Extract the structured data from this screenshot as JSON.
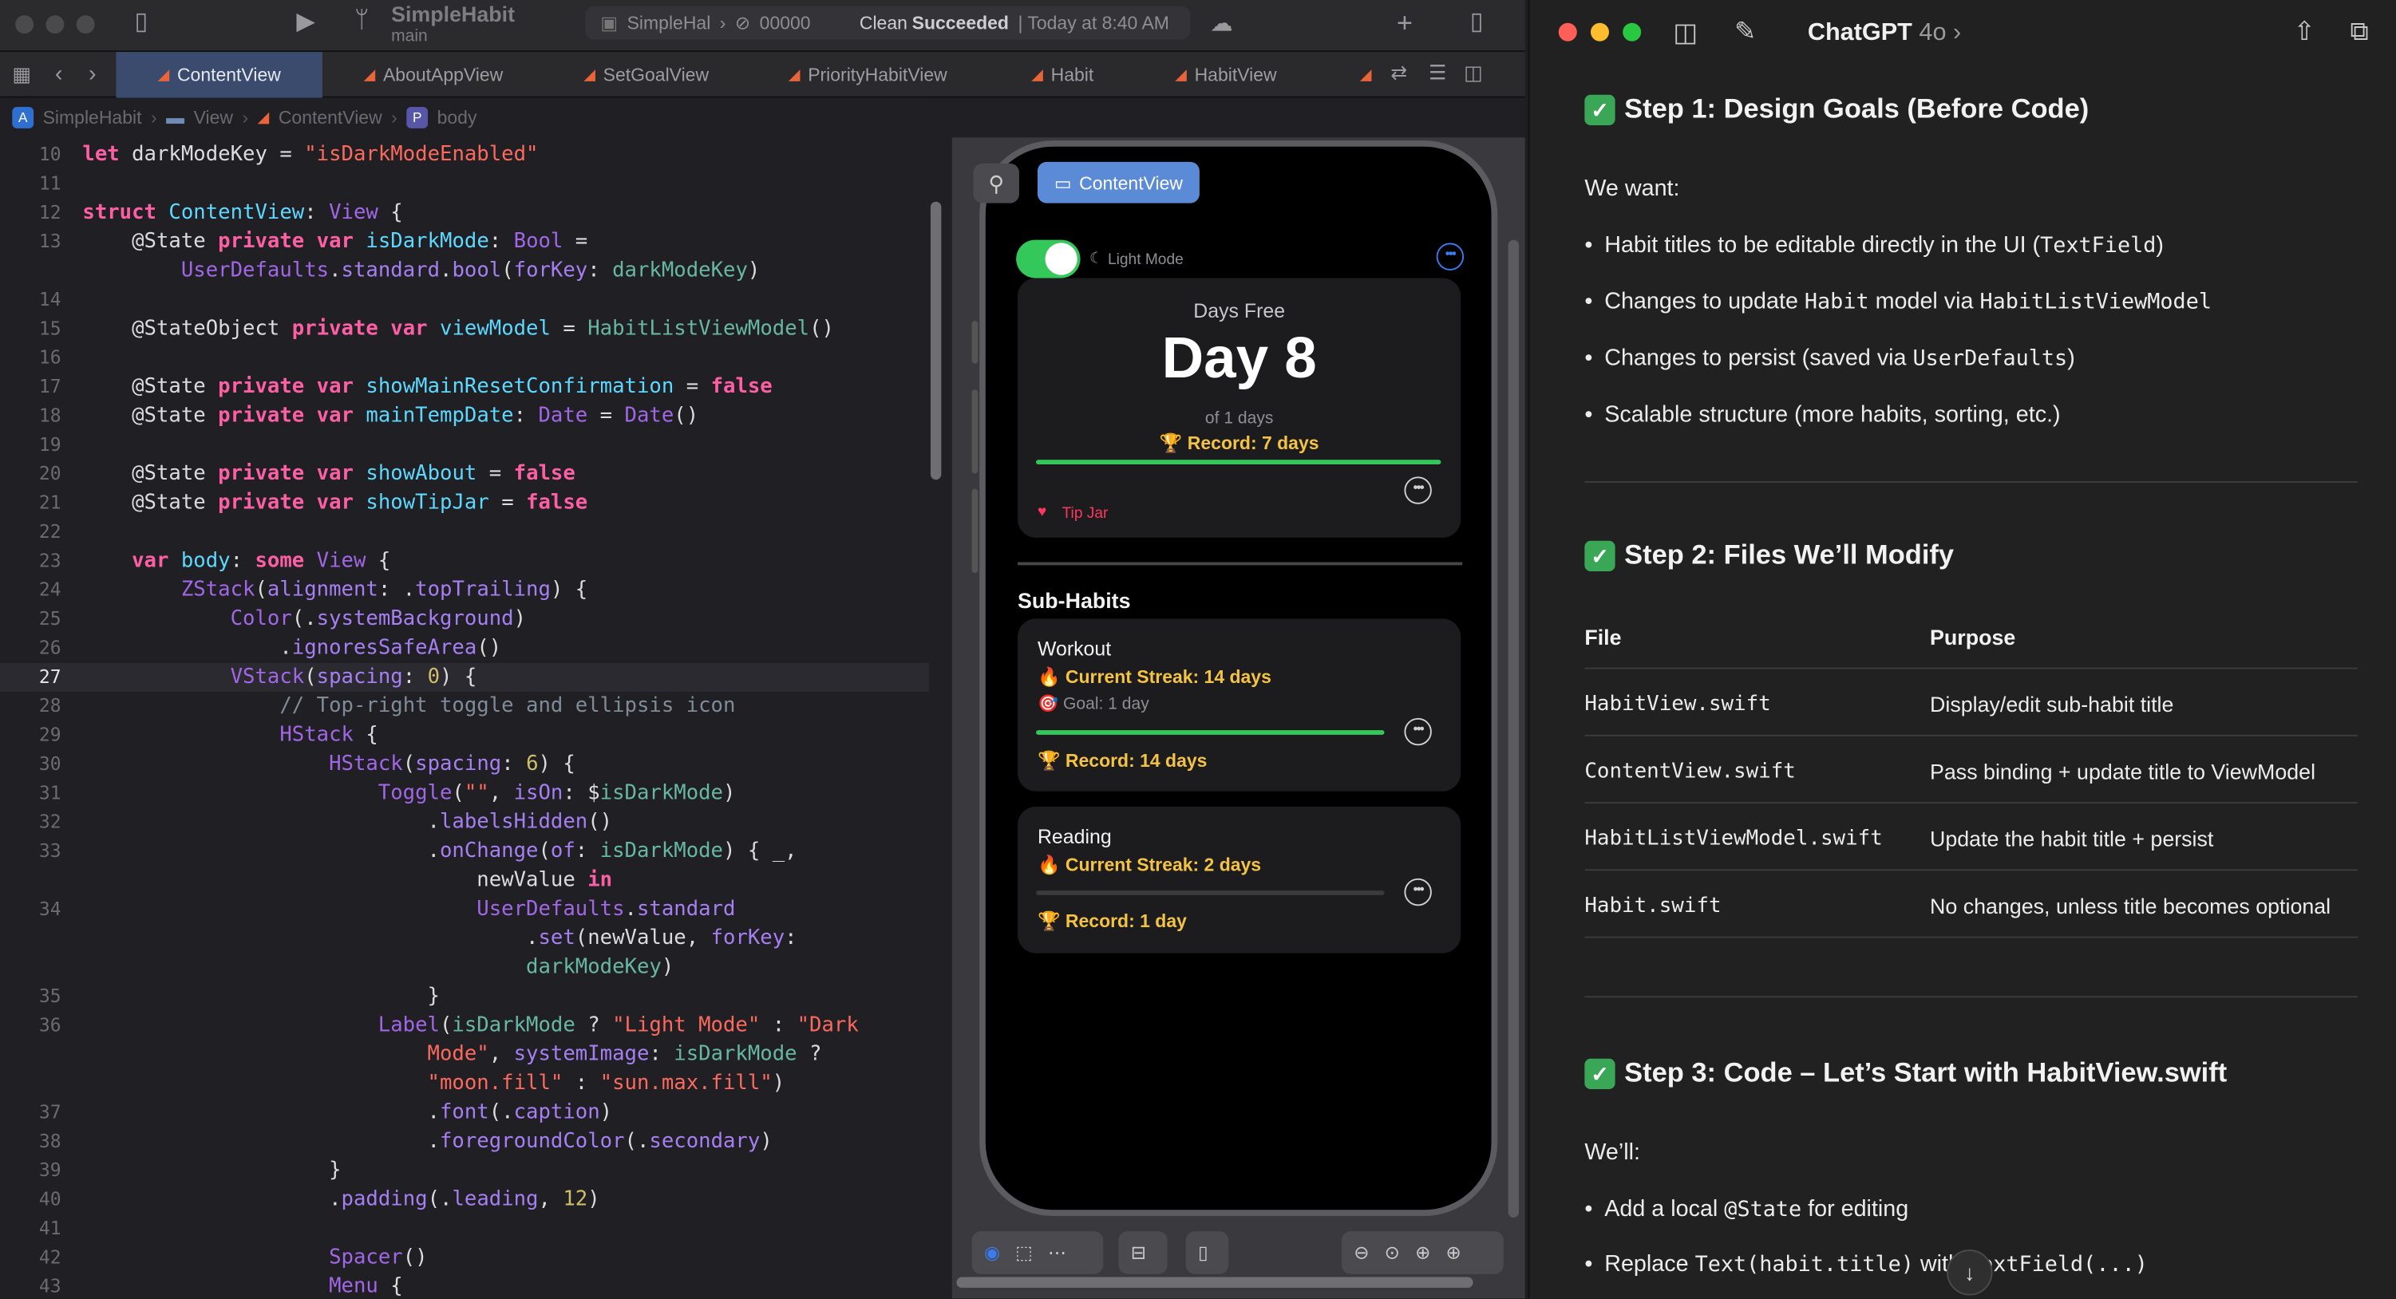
{
  "xcode": {
    "project_name": "SimpleHabit",
    "branch": "main",
    "status": {
      "scheme": "SimpleHal",
      "device": "00000",
      "message_prefix": "Clean",
      "message_strong": "Succeeded",
      "message_time": "| Today at 8:40 AM"
    },
    "tabs": [
      "ContentView",
      "AboutAppView",
      "SetGoalView",
      "PriorityHabitView",
      "Habit",
      "HabitView"
    ],
    "jumpbar": [
      "SimpleHabit",
      "View",
      "ContentView",
      "body"
    ],
    "code_lines": [
      {
        "n": "10",
        "html": "<span class=\"kw\">let</span> darkModeKey = <span class=\"st\">\"isDarkModeEnabled\"</span>"
      },
      {
        "n": "11",
        "html": ""
      },
      {
        "n": "12",
        "html": "<span class=\"kw\">struct</span> <span class=\"tz\">ContentView</span>: <span class=\"ty\">View</span> {"
      },
      {
        "n": "13",
        "html": "    @State <span class=\"kw\">private var</span> <span class=\"tz\">isDarkMode</span>: <span class=\"ty\">Bool</span> ="
      },
      {
        "n": "",
        "html": "        <span class=\"ty\">UserDefaults</span>.<span class=\"pr\">standard</span>.<span class=\"pr\">bool</span>(<span class=\"pr\">forKey</span>: <span class=\"fn\">darkModeKey</span>)"
      },
      {
        "n": "14",
        "html": ""
      },
      {
        "n": "15",
        "html": "    @StateObject <span class=\"kw\">private var</span> <span class=\"tz\">viewModel</span> = <span class=\"fn\">HabitListViewModel</span>()"
      },
      {
        "n": "16",
        "html": ""
      },
      {
        "n": "17",
        "html": "    @State <span class=\"kw\">private var</span> <span class=\"tz\">showMainResetConfirmation</span> = <span class=\"kw\">false</span>"
      },
      {
        "n": "18",
        "html": "    @State <span class=\"kw\">private var</span> <span class=\"tz\">mainTempDate</span>: <span class=\"ty\">Date</span> = <span class=\"ty\">Date</span>()"
      },
      {
        "n": "19",
        "html": ""
      },
      {
        "n": "20",
        "html": "    @State <span class=\"kw\">private var</span> <span class=\"tz\">showAbout</span> = <span class=\"kw\">false</span>"
      },
      {
        "n": "21",
        "html": "    @State <span class=\"kw\">private var</span> <span class=\"tz\">showTipJar</span> = <span class=\"kw\">false</span>"
      },
      {
        "n": "22",
        "html": ""
      },
      {
        "n": "23",
        "html": "    <span class=\"kw\">var</span> <span class=\"tz\">body</span>: <span class=\"kw\">some</span> <span class=\"ty\">View</span> {"
      },
      {
        "n": "24",
        "html": "        <span class=\"ty\">ZStack</span>(<span class=\"pr\">alignment</span>: .<span class=\"pr\">topTrailing</span>) {"
      },
      {
        "n": "25",
        "html": "            <span class=\"ty\">Color</span>(.<span class=\"pr\">systemBackground</span>)"
      },
      {
        "n": "26",
        "html": "                .<span class=\"pr\">ignoresSafeArea</span>()"
      },
      {
        "n": "27",
        "html": "            <span class=\"ty\">VStack</span>(<span class=\"pr\">spacing</span>: <span class=\"nm\">0</span>) {",
        "current": true
      },
      {
        "n": "28",
        "html": "                <span class=\"cm\">// Top-right toggle and ellipsis icon</span>"
      },
      {
        "n": "29",
        "html": "                <span class=\"ty\">HStack</span> {"
      },
      {
        "n": "30",
        "html": "                    <span class=\"ty\">HStack</span>(<span class=\"pr\">spacing</span>: <span class=\"nm\">6</span>) {"
      },
      {
        "n": "31",
        "html": "                        <span class=\"ty\">Toggle</span>(<span class=\"st\">\"\"</span>, <span class=\"pr\">isOn</span>: $<span class=\"fn\">isDarkMode</span>)"
      },
      {
        "n": "32",
        "html": "                            .<span class=\"pr\">labelsHidden</span>()"
      },
      {
        "n": "33",
        "html": "                            .<span class=\"pr\">onChange</span>(<span class=\"pr\">of</span>: <span class=\"fn\">isDarkMode</span>) { _,"
      },
      {
        "n": "",
        "html": "                                newValue <span class=\"kw\">in</span>"
      },
      {
        "n": "34",
        "html": "                                <span class=\"ty\">UserDefaults</span>.<span class=\"pr\">standard</span>"
      },
      {
        "n": "",
        "html": "                                    .<span class=\"pr\">set</span>(newValue, <span class=\"pr\">forKey</span>:"
      },
      {
        "n": "",
        "html": "                                    <span class=\"fn\">darkModeKey</span>)"
      },
      {
        "n": "35",
        "html": "                            }"
      },
      {
        "n": "36",
        "html": "                        <span class=\"ty\">Label</span>(<span class=\"fn\">isDarkMode</span> ? <span class=\"st\">\"Light Mode\"</span> : <span class=\"st\">\"Dark</span>"
      },
      {
        "n": "",
        "html": "                            <span class=\"st\">Mode\"</span>, <span class=\"pr\">systemImage</span>: <span class=\"fn\">isDarkMode</span> ?"
      },
      {
        "n": "",
        "html": "                            <span class=\"st\">\"moon.fill\"</span> : <span class=\"st\">\"sun.max.fill\"</span>)"
      },
      {
        "n": "37",
        "html": "                            .<span class=\"pr\">font</span>(.<span class=\"pr\">caption</span>)"
      },
      {
        "n": "38",
        "html": "                            .<span class=\"pr\">foregroundColor</span>(.<span class=\"pr\">secondary</span>)"
      },
      {
        "n": "39",
        "html": "                    }"
      },
      {
        "n": "40",
        "html": "                    .<span class=\"pr\">padding</span>(.<span class=\"pr\">leading</span>, <span class=\"nm\">12</span>)"
      },
      {
        "n": "41",
        "html": ""
      },
      {
        "n": "42",
        "html": "                    <span class=\"ty\">Spacer</span>()"
      },
      {
        "n": "43",
        "html": "                    <span class=\"ty\">Menu</span> {"
      }
    ],
    "preview": {
      "chip_label": "ContentView",
      "toggle_label": "Light Mode",
      "main_card": {
        "caption": "Days Free",
        "day_label": "Day 8",
        "of_label": "of 1 days",
        "record": "🏆 Record: 7 days",
        "tip_jar": "Tip Jar",
        "progress": 1.0
      },
      "section_title": "Sub-Habits",
      "sub_habits": [
        {
          "title": "Workout",
          "streak": "🔥 Current Streak: 14 days",
          "goal": "🎯 Goal: 1 day",
          "record": "🏆 Record: 14 days",
          "progress": 1.0
        },
        {
          "title": "Reading",
          "streak": "🔥 Current Streak: 2 days",
          "goal": "",
          "record": "🏆 Record: 1 day",
          "progress": 0.0
        }
      ]
    }
  },
  "chat": {
    "title": "ChatGPT",
    "model": "4o",
    "step1": {
      "heading": "Step 1: Design Goals (Before Code)",
      "intro": "We want:",
      "bullets": [
        {
          "a": "Habit titles to be editable directly in the UI (",
          "m": "TextField",
          "b": ")"
        },
        {
          "a": "Changes to update ",
          "m": "Habit",
          "b": " model via ",
          "m2": "HabitListViewModel"
        },
        {
          "a": "Changes to persist (saved via ",
          "m": "UserDefaults",
          "b": ")"
        },
        {
          "a": "Scalable structure (more habits, sorting, etc.)",
          "m": "",
          "b": ""
        }
      ]
    },
    "step2": {
      "heading": "Step 2: Files We’ll Modify",
      "col_file": "File",
      "col_purpose": "Purpose",
      "rows": [
        {
          "file": "HabitView.swift",
          "purpose": "Display/edit sub-habit title"
        },
        {
          "file": "ContentView.swift",
          "purpose": "Pass binding + update title to ViewModel"
        },
        {
          "file": "HabitListViewModel.swift",
          "purpose": "Update the habit title + persist"
        },
        {
          "file": "Habit.swift",
          "purpose": "No changes, unless title becomes optional"
        }
      ]
    },
    "step3": {
      "heading": "Step 3: Code – Let’s Start with HabitView.swift",
      "intro": "We’ll:",
      "b1_a": "Add a local ",
      "b1_m": "@State",
      "b1_b": " for editing",
      "b2_a": "Replace ",
      "b2_m": "Text(habit.title)",
      "b2_b": " with ",
      "b2_m2": "TextField(...)"
    }
  }
}
